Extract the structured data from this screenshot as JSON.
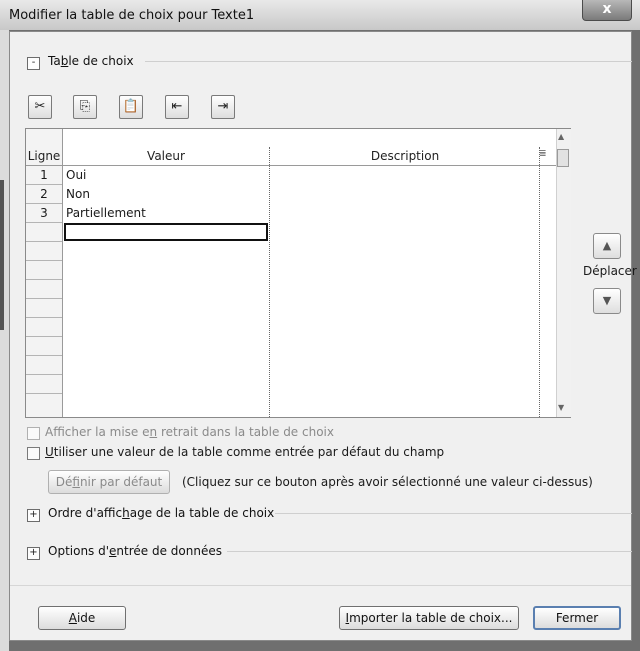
{
  "window": {
    "title": "Modifier la table de choix pour Texte1",
    "close_label": "x"
  },
  "section_table": {
    "toggle": "-",
    "label_pre": "Ta",
    "label_accel": "b",
    "label_post": "le de choix"
  },
  "toolbar": {
    "buttons": [
      {
        "name": "cut",
        "glyph": "✂"
      },
      {
        "name": "copy",
        "glyph": "⎘"
      },
      {
        "name": "paste",
        "glyph": "📋"
      },
      {
        "name": "insert-row",
        "glyph": "⇤"
      },
      {
        "name": "delete-row",
        "glyph": "⇥"
      }
    ]
  },
  "grid": {
    "columns": {
      "row": "Ligne",
      "value": "Valeur",
      "description": "Description"
    },
    "rows": [
      {
        "n": "1",
        "value": "Oui",
        "description": ""
      },
      {
        "n": "2",
        "value": "Non",
        "description": ""
      },
      {
        "n": "3",
        "value": "Partiellement",
        "description": ""
      }
    ]
  },
  "move": {
    "label": "Déplacer",
    "up": "▲",
    "down": "▼"
  },
  "options": {
    "show_indent": {
      "pre": "Afficher la mise e",
      "accel": "n",
      "post": " retrait dans la table de choix",
      "checked": false,
      "enabled": false
    },
    "use_default": {
      "pre": "",
      "accel": "U",
      "post": "tiliser une valeur de la table comme entrée par défaut du champ",
      "checked": false
    },
    "set_default_button": {
      "pre": "Dé",
      "accel": "f",
      "post": "inir par défaut"
    },
    "set_default_hint": "(Cliquez sur ce bouton après avoir sélectionné une valeur ci-dessus)"
  },
  "section_order": {
    "toggle": "+",
    "label_pre": "Ordre d'affic",
    "label_accel": "h",
    "label_post": "age de la table de choix"
  },
  "section_entry": {
    "toggle": "+",
    "label_pre": "Options d'",
    "label_accel": "e",
    "label_post": "ntrée de données"
  },
  "footer": {
    "help": {
      "pre": "",
      "accel": "A",
      "post": "ide"
    },
    "import": {
      "pre": "",
      "accel": "I",
      "post": "mporter la table de choix..."
    },
    "close": "Fermer"
  },
  "colors": {
    "dialog_bg": "#f0f0f0",
    "disabled_text": "#8a8a8a"
  }
}
